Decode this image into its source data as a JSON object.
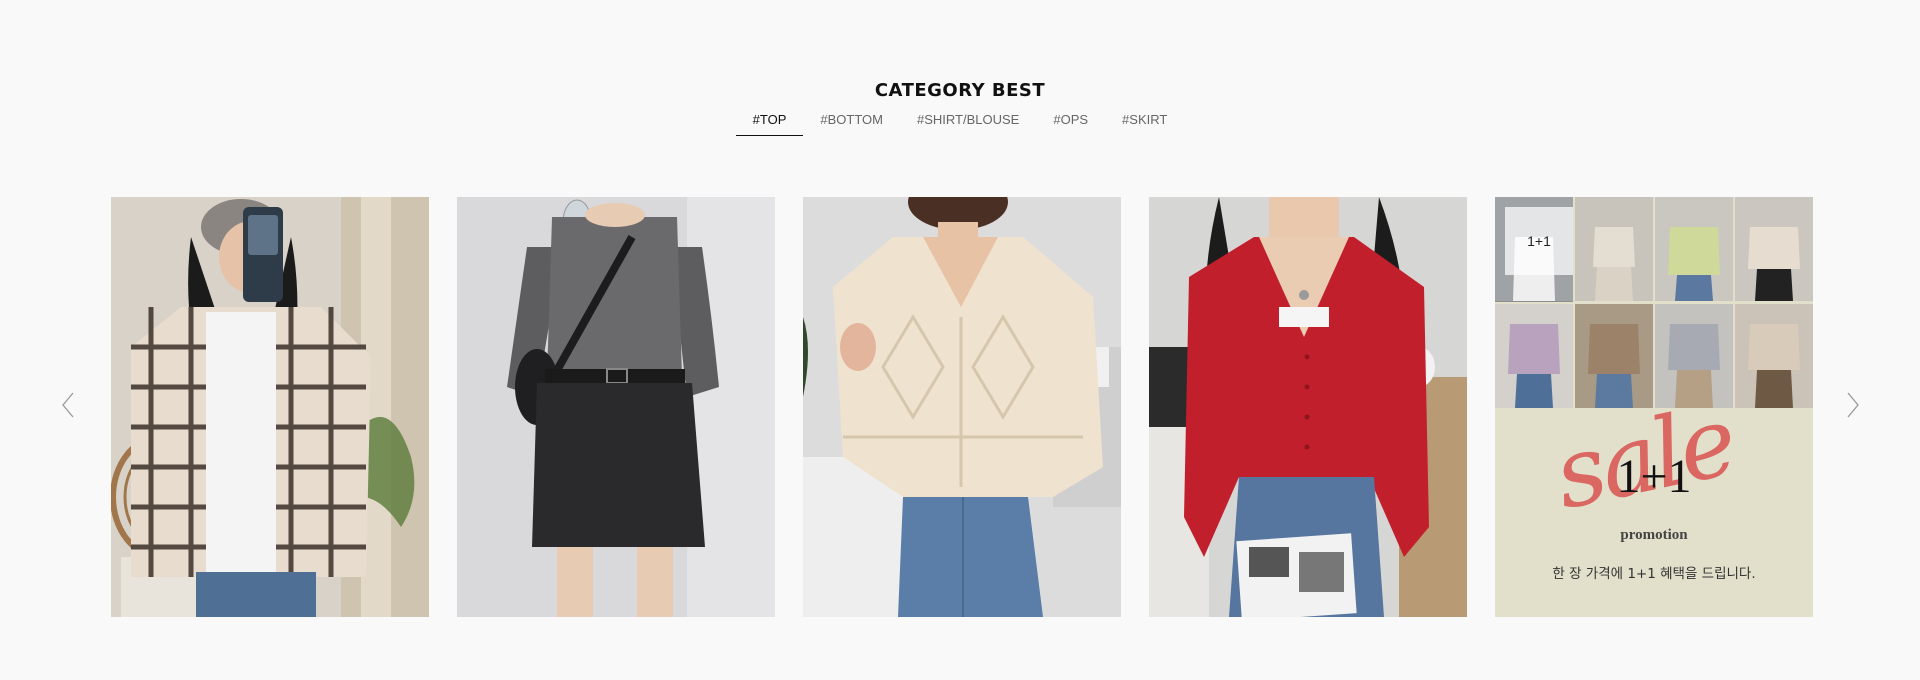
{
  "section": {
    "title": "CATEGORY BEST"
  },
  "tabs": [
    {
      "label": "#TOP",
      "active": true
    },
    {
      "label": "#BOTTOM",
      "active": false
    },
    {
      "label": "#SHIRT/BLOUSE",
      "active": false
    },
    {
      "label": "#OPS",
      "active": false
    },
    {
      "label": "#SKIRT",
      "active": false
    }
  ],
  "carousel": {
    "prev_icon": "chevron-left-icon",
    "next_icon": "chevron-right-icon",
    "products": [
      {
        "image": "plaid-shirt-photo"
      },
      {
        "image": "grey-tee-black-skirt-photo"
      },
      {
        "image": "cream-knit-sweater-photo"
      },
      {
        "image": "red-cardigan-photo"
      }
    ],
    "promo": {
      "badge": "1+1",
      "script_word": "sale",
      "big_text": "1+1",
      "label": "promotion",
      "description": "한 장 가격에 1+1 혜택을 드립니다."
    }
  },
  "colors": {
    "background": "#f9f9f9",
    "promo_bg": "#e2dfcb",
    "sale_red": "#d9534f"
  }
}
